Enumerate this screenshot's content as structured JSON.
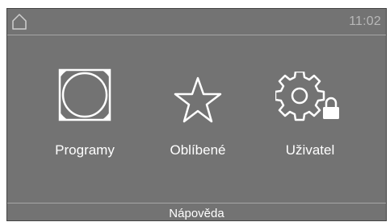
{
  "status_bar": {
    "home_icon": "home-outline-icon",
    "time": "11:02"
  },
  "menu": {
    "items": [
      {
        "label": "Programy",
        "icon": "drum-icon"
      },
      {
        "label": "Oblíbené",
        "icon": "star-icon"
      },
      {
        "label": "Uživatel",
        "icon": "gear-lock-icon"
      }
    ]
  },
  "footer": {
    "help_label": "Nápověda"
  },
  "colors": {
    "background": "#737373",
    "text": "#ffffff",
    "time_text": "#b8b8b8",
    "divider": "#a6a6a6"
  }
}
